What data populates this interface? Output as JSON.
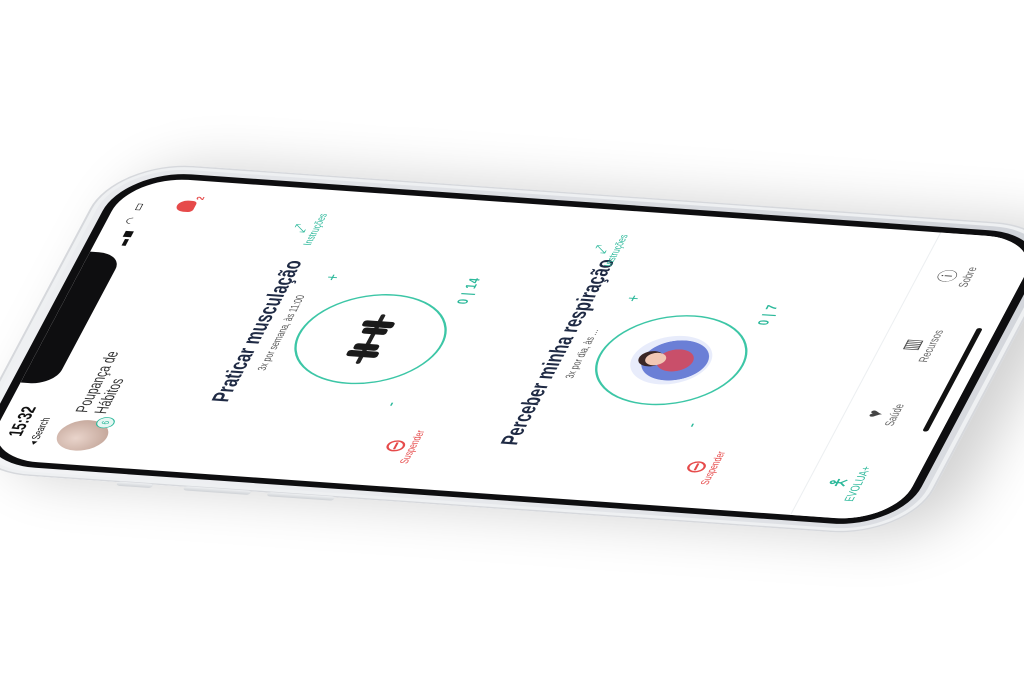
{
  "status": {
    "time": "15:32",
    "back_label": "◂ Search",
    "icons": "▂▄ ◠ ▭"
  },
  "header": {
    "title": "Poupança de Hábitos",
    "avatar_badge": "6",
    "notification_count": "2"
  },
  "habits": [
    {
      "title": "Praticar musculação",
      "subtitle": "3x por semana, às 11:00",
      "instructions_label": "Instruções",
      "plus": "+",
      "minus": "-",
      "count": "0 | 14",
      "suspend_label": "Suspender",
      "art": "dumbbell-icon"
    },
    {
      "title": "Perceber minha respiração",
      "subtitle": "3x por dia, às ...",
      "instructions_label": "Instruções",
      "plus": "+",
      "minus": "-",
      "count": "0 | 7",
      "suspend_label": "Suspender",
      "art": "breathing-person-illustration"
    }
  ],
  "tabbar": {
    "items": [
      {
        "label": "EVOLUA+",
        "icon": "figure-icon",
        "active": true
      },
      {
        "label": "Saúde",
        "icon": "health-icon",
        "active": false
      },
      {
        "label": "Recursos",
        "icon": "books-icon",
        "active": false
      },
      {
        "label": "Sobre",
        "icon": "info-icon",
        "active": false
      }
    ]
  },
  "colors": {
    "accent": "#2bb89a",
    "danger": "#e64a4a",
    "title": "#1f2a44"
  }
}
